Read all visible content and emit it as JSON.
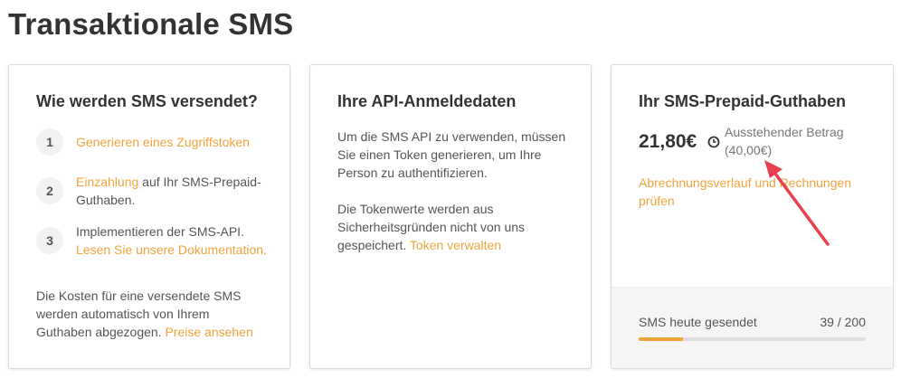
{
  "page": {
    "title": "Transaktionale SMS"
  },
  "send_card": {
    "title": "Wie werden SMS versendet?",
    "steps": [
      {
        "number": "1",
        "link": "Generieren eines Zugriffstoken"
      },
      {
        "number": "2",
        "link": "Einzahlung",
        "text": " auf Ihr SMS-Prepaid-Guthaben."
      },
      {
        "number": "3",
        "text": "Implementieren der SMS-API.",
        "link": "Lesen Sie unsere Dokumentation."
      }
    ],
    "footer_text": "Die Kosten für eine versendete SMS werden automatisch von Ihrem Guthaben abgezogen. ",
    "footer_link": "Preise ansehen"
  },
  "api_card": {
    "title": "Ihre API-Anmeldedaten",
    "paragraph1": "Um die SMS API zu verwenden, müssen Sie einen Token generieren, um Ihre Person zu authentifizieren.",
    "paragraph2": "Die Tokenwerte werden aus Sicherheitsgründen nicht von uns gespeichert. ",
    "paragraph2_link": "Token verwalten"
  },
  "balance_card": {
    "title": "Ihr SMS-Prepaid-Guthaben",
    "amount": "21,80€",
    "pending_label": "Ausstehender Betrag",
    "pending_amount": "(40,00€)",
    "billing_link": "Abrechnungsverlauf und Rechnungen prüfen",
    "sent_label": "SMS heute gesendet",
    "sent_count": "39 / 200",
    "sent_progress": 0.195
  },
  "icons": {
    "pending": "clock-icon"
  },
  "colors": {
    "accent": "#f0a43c",
    "annotation_arrow": "#e8404f"
  }
}
